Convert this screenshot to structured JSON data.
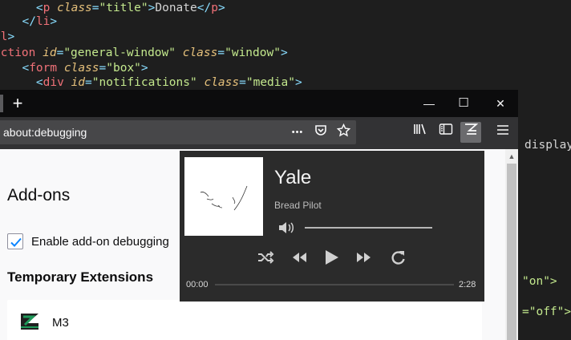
{
  "editor": {
    "lines": [
      {
        "indent": "    ",
        "parts": [
          [
            "pun",
            "<"
          ],
          [
            "tag",
            "p "
          ],
          [
            "attr",
            "class"
          ],
          [
            "pun",
            "="
          ],
          [
            "str",
            "\"title\""
          ],
          [
            "pun",
            ">"
          ],
          [
            "plain",
            "Donate"
          ],
          [
            "pun",
            "</"
          ],
          [
            "tag",
            "p"
          ],
          [
            "pun",
            ">"
          ]
        ]
      },
      {
        "indent": "  ",
        "parts": [
          [
            "pun",
            "</"
          ],
          [
            "tag",
            "li"
          ],
          [
            "pun",
            ">"
          ]
        ]
      },
      {
        "indent": "",
        "parts": [
          [
            "tag",
            "ul"
          ],
          [
            "pun",
            ">"
          ]
        ]
      },
      {
        "indent": "",
        "parts": [
          [
            "tag",
            "ection "
          ],
          [
            "attr",
            "id"
          ],
          [
            "pun",
            "="
          ],
          [
            "str",
            "\"general-window\" "
          ],
          [
            "attr",
            "class"
          ],
          [
            "pun",
            "="
          ],
          [
            "str",
            "\"window\""
          ],
          [
            "pun",
            ">"
          ]
        ]
      },
      {
        "indent": "  ",
        "parts": [
          [
            "pun",
            "<"
          ],
          [
            "tag",
            "form "
          ],
          [
            "attr",
            "class"
          ],
          [
            "pun",
            "="
          ],
          [
            "str",
            "\"box\""
          ],
          [
            "pun",
            ">"
          ]
        ]
      },
      {
        "indent": "    ",
        "parts": [
          [
            "pun",
            "<"
          ],
          [
            "tag",
            "div "
          ],
          [
            "attr",
            "id"
          ],
          [
            "pun",
            "="
          ],
          [
            "str",
            "\"notifications\" "
          ],
          [
            "attr",
            "class"
          ],
          [
            "pun",
            "="
          ],
          [
            "str",
            "\"media\""
          ],
          [
            "pun",
            ">"
          ]
        ]
      }
    ],
    "side_fragments": [
      {
        "text": "display",
        "color": "plain"
      },
      {
        "text": "\"on\">",
        "color": "str"
      },
      {
        "text": "=\"off\">",
        "color": "str"
      }
    ]
  },
  "browser": {
    "new_tab_symbol": "+",
    "window_controls": {
      "minimize": "—",
      "maximize": "☐",
      "close": "✕"
    },
    "url": "about:debugging",
    "page_actions": {
      "more": "•••"
    },
    "page": {
      "heading": "Add-ons",
      "checkbox_label": "Enable add-on debugging",
      "checkbox_checked": true,
      "section_title": "Temporary Extensions",
      "extension_name": "M3"
    }
  },
  "player": {
    "title": "Yale",
    "artist": "Bread Pilot",
    "elapsed": "00:00",
    "duration": "2:28",
    "progress": 0,
    "volume": 1.0
  },
  "colors": {
    "accent_green": "#1f9a5a",
    "check_blue": "#0a84ff"
  }
}
